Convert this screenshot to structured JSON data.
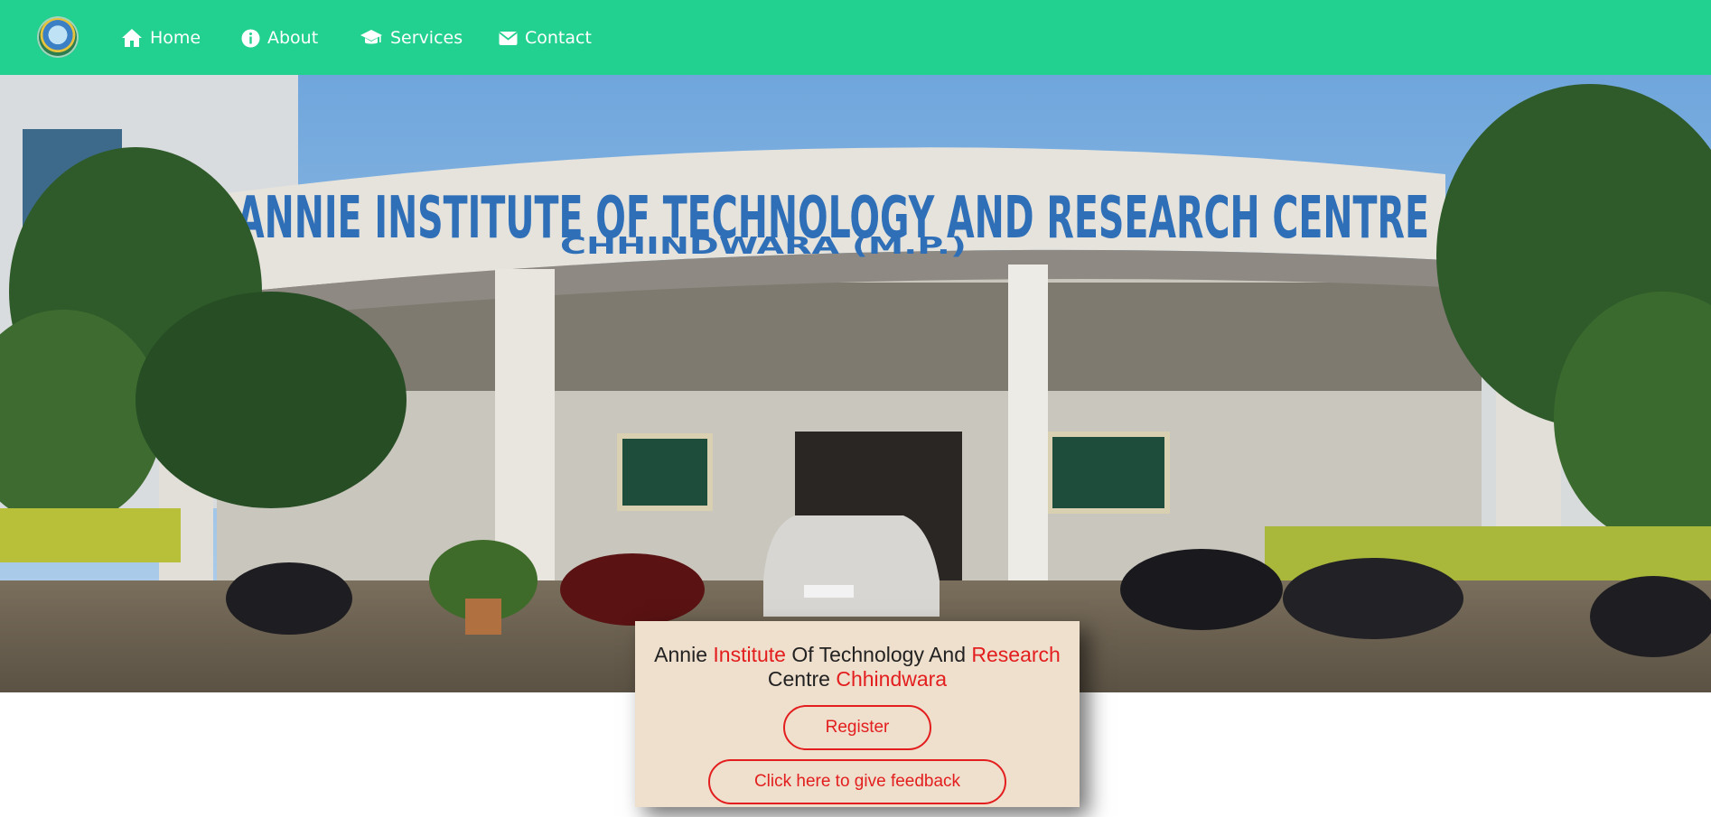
{
  "nav": {
    "logo_icon": "institute-logo",
    "items": [
      {
        "label": "Home",
        "icon": "home-icon"
      },
      {
        "label": "About",
        "icon": "info-icon"
      },
      {
        "label": "Services",
        "icon": "graduation-cap-icon"
      },
      {
        "label": "Contact",
        "icon": "envelope-icon"
      }
    ]
  },
  "hero": {
    "sign_main": "ANNIE INSTITUTE OF TECHNOLOGY AND RESEARCH CENTRE",
    "sign_sub": "CHHINDWARA (M.P.)"
  },
  "card": {
    "title_parts": [
      "Annie ",
      "Institute",
      " Of Technology And ",
      "Research",
      " Centre ",
      "Chhindwara"
    ],
    "register_label": "Register",
    "feedback_label": "Click here to give feedback"
  },
  "colors": {
    "navbar": "#22d08f",
    "accent_red": "#e31e1e",
    "card_bg": "#efdfcd"
  }
}
